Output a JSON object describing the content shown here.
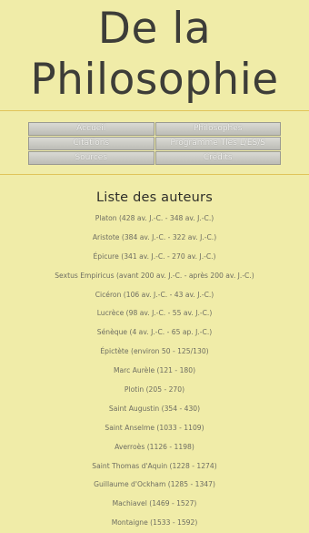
{
  "header": {
    "title_line1": "De la",
    "title_line2": "Philosophie"
  },
  "nav": {
    "items": [
      {
        "label": "Accueil"
      },
      {
        "label": "Philosophes"
      },
      {
        "label": "Citations"
      },
      {
        "label": "Programme Tles L/ES/S"
      },
      {
        "label": "Sources"
      },
      {
        "label": "Crédits"
      }
    ]
  },
  "main": {
    "section_title": "Liste des auteurs",
    "authors": [
      "Platon (428 av. J.-C. - 348 av. J.-C.)",
      "Aristote (384 av. J.-C. - 322 av. J.-C.)",
      "Épicure (341 av. J.-C. - 270 av. J.-C.)",
      "Sextus Empiricus (avant 200 av. J.-C. - après 200 av. J.-C.)",
      "Cicéron (106 av. J.-C. - 43 av. J.-C.)",
      "Lucrèce (98 av. J.-C. - 55 av. J.-C.)",
      "Sénèque (4 av. J.-C. - 65 ap. J.-C.)",
      "Épictète (environ 50 - 125/130)",
      "Marc Aurèle (121 - 180)",
      "Plotin (205 - 270)",
      "Saint Augustin (354 - 430)",
      "Saint Anselme (1033 - 1109)",
      "Averroès (1126 - 1198)",
      "Saint Thomas d'Aquin (1228 - 1274)",
      "Guillaume d'Ockham (1285 - 1347)",
      "Machiavel (1469 - 1527)",
      "Montaigne (1533 - 1592)"
    ]
  }
}
